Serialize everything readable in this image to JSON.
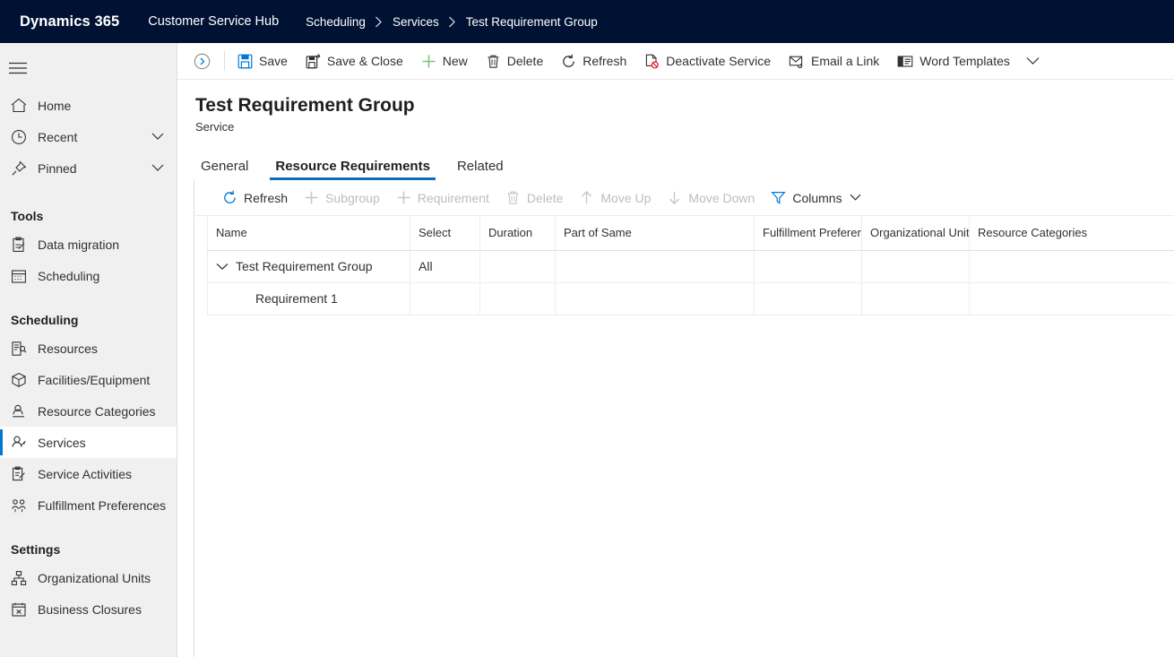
{
  "topbar": {
    "brand": "Dynamics 365",
    "app_name": "Customer Service Hub",
    "breadcrumbs": [
      "Scheduling",
      "Services",
      "Test Requirement Group"
    ]
  },
  "sidebar": {
    "menu_icon": "hamburger-icon",
    "items": [
      {
        "label": "Home",
        "icon": "home-icon",
        "chevron": false,
        "selected": false
      },
      {
        "label": "Recent",
        "icon": "clock-icon",
        "chevron": true,
        "selected": false
      },
      {
        "label": "Pinned",
        "icon": "pin-icon",
        "chevron": true,
        "selected": false
      }
    ],
    "groups": [
      {
        "title": "Tools",
        "items": [
          {
            "label": "Data migration",
            "icon": "data-migration-icon",
            "selected": false
          },
          {
            "label": "Scheduling",
            "icon": "calendar-icon",
            "selected": false
          }
        ]
      },
      {
        "title": "Scheduling",
        "items": [
          {
            "label": "Resources",
            "icon": "resources-icon",
            "selected": false
          },
          {
            "label": "Facilities/Equipment",
            "icon": "facilities-icon",
            "selected": false
          },
          {
            "label": "Resource Categories",
            "icon": "resource-categories-icon",
            "selected": false
          },
          {
            "label": "Services",
            "icon": "services-icon",
            "selected": true
          },
          {
            "label": "Service Activities",
            "icon": "service-activities-icon",
            "selected": false
          },
          {
            "label": "Fulfillment Preferences",
            "icon": "fulfillment-preferences-icon",
            "selected": false
          }
        ]
      },
      {
        "title": "Settings",
        "items": [
          {
            "label": "Organizational Units",
            "icon": "org-units-icon",
            "selected": false
          },
          {
            "label": "Business Closures",
            "icon": "business-closures-icon",
            "selected": false
          }
        ]
      }
    ]
  },
  "command_bar": {
    "expand_button": "chevron-right-circle-icon",
    "commands": [
      {
        "label": "Save",
        "icon": "save-icon",
        "disabled": false
      },
      {
        "label": "Save & Close",
        "icon": "save-and-close-icon",
        "disabled": false
      },
      {
        "label": "New",
        "icon": "plus-icon",
        "disabled": false
      },
      {
        "label": "Delete",
        "icon": "trash-icon",
        "disabled": false
      },
      {
        "label": "Refresh",
        "icon": "refresh-icon",
        "disabled": false
      },
      {
        "label": "Deactivate Service",
        "icon": "deactivate-icon",
        "disabled": false
      },
      {
        "label": "Email a Link",
        "icon": "email-link-icon",
        "disabled": false
      },
      {
        "label": "Word Templates",
        "icon": "word-templates-icon",
        "disabled": false
      }
    ],
    "overflow_icon": "chevron-down-icon"
  },
  "record": {
    "title": "Test Requirement Group",
    "entity": "Service"
  },
  "tabs": [
    {
      "label": "General",
      "active": false
    },
    {
      "label": "Resource Requirements",
      "active": true
    },
    {
      "label": "Related",
      "active": false
    }
  ],
  "grid_command_bar": [
    {
      "label": "Refresh",
      "icon": "refresh-icon",
      "disabled": false
    },
    {
      "label": "Subgroup",
      "icon": "plus-icon",
      "disabled": true
    },
    {
      "label": "Requirement",
      "icon": "plus-icon",
      "disabled": true
    },
    {
      "label": "Delete",
      "icon": "trash-icon",
      "disabled": true
    },
    {
      "label": "Move Up",
      "icon": "arrow-up-icon",
      "disabled": true
    },
    {
      "label": "Move Down",
      "icon": "arrow-down-icon",
      "disabled": true
    },
    {
      "label": "Columns",
      "icon": "filter-icon",
      "disabled": false,
      "chevron": true
    }
  ],
  "grid": {
    "columns": [
      "Name",
      "Select",
      "Duration",
      "Part of Same",
      "Fulfillment Preferenc",
      "Organizational Unit",
      "Resource Categories"
    ],
    "rows": [
      {
        "name": "Test Requirement Group",
        "expanded": true,
        "indent": 0,
        "select": "All",
        "duration": "",
        "part_of_same": "",
        "fulfillment_preference": "",
        "organizational_unit": "",
        "resource_categories": ""
      },
      {
        "name": "Requirement 1",
        "expanded": null,
        "indent": 1,
        "select": "",
        "duration": "",
        "part_of_same": "",
        "fulfillment_preference": "",
        "organizational_unit": "",
        "resource_categories": ""
      }
    ]
  },
  "colors": {
    "topbar_bg": "#001233",
    "accent": "#0078d4",
    "tab_underline": "#0f6cbd",
    "new_icon_green": "#7cc576",
    "deactivate_red": "#e81123",
    "sidebar_bg": "#f0f0f0"
  }
}
